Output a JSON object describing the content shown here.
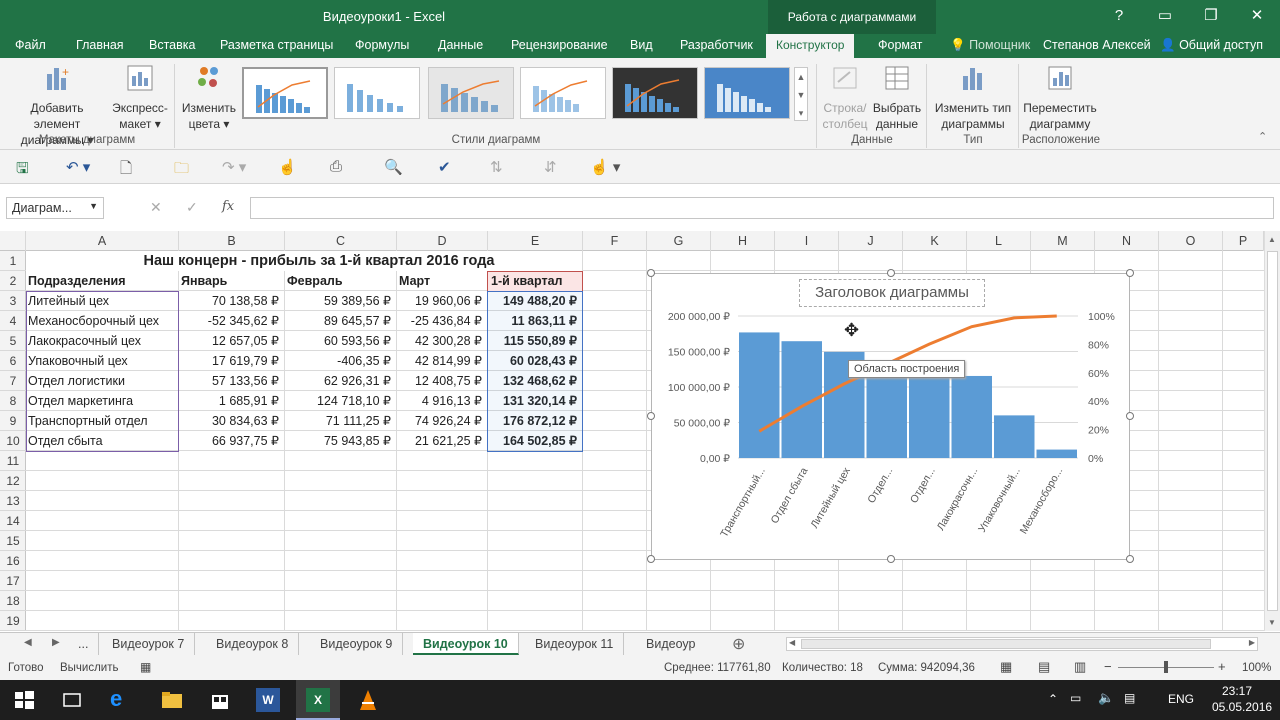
{
  "window": {
    "title": "Видеоуроки1 - Excel",
    "context_group": "Работа с диаграммами",
    "controls": [
      "?",
      "▭",
      "❐",
      "✕"
    ]
  },
  "ribbon_tabs": [
    "Файл",
    "Главная",
    "Вставка",
    "Разметка страницы",
    "Формулы",
    "Данные",
    "Рецензирование",
    "Вид",
    "Разработчик",
    "Конструктор",
    "Формат"
  ],
  "tell_me": "Помощник",
  "user_name": "Степанов Алексей",
  "share_label": "Общий доступ",
  "ribbon": {
    "add_element": [
      "Добавить элемент",
      "диаграммы ▾"
    ],
    "express_layout": [
      "Экспресс-",
      "макет ▾"
    ],
    "change_colors": [
      "Изменить",
      "цвета ▾"
    ],
    "group_layouts": "Макеты диаграмм",
    "group_styles": "Стили диаграмм",
    "row_col": [
      "Строка/",
      "столбец"
    ],
    "select_data": [
      "Выбрать",
      "данные"
    ],
    "group_data": "Данные",
    "change_type": [
      "Изменить тип",
      "диаграммы"
    ],
    "group_type": "Тип",
    "move_chart": [
      "Переместить",
      "диаграмму"
    ],
    "group_location": "Расположение"
  },
  "namebox": "Диаграм...",
  "fx": "fx",
  "columns": [
    "A",
    "B",
    "C",
    "D",
    "E",
    "F",
    "G",
    "H",
    "I",
    "J",
    "K",
    "L",
    "M",
    "N",
    "O",
    "P"
  ],
  "rows": [
    "1",
    "2",
    "3",
    "4",
    "5",
    "6",
    "7",
    "8",
    "9",
    "10",
    "11",
    "12",
    "13",
    "14",
    "15",
    "16",
    "17",
    "18",
    "19"
  ],
  "sheet_title": "Наш концерн - прибыль за 1-й квартал 2016 года",
  "table_headers": [
    "Подразделения",
    "Январь",
    "Февраль",
    "Март",
    "1-й квартал"
  ],
  "table_rows": [
    [
      "Литейный цех",
      "70 138,58 ₽",
      "59 389,56 ₽",
      "19 960,06 ₽",
      "149 488,20 ₽"
    ],
    [
      "Механосборочный цех",
      "-52 345,62 ₽",
      "89 645,57 ₽",
      "-25 436,84 ₽",
      "11 863,11 ₽"
    ],
    [
      "Лакокрасочный цех",
      "12 657,05 ₽",
      "60 593,56 ₽",
      "42 300,28 ₽",
      "115 550,89 ₽"
    ],
    [
      "Упаковочный цех",
      "17 619,79 ₽",
      "-406,35 ₽",
      "42 814,99 ₽",
      "60 028,43 ₽"
    ],
    [
      "Отдел логистики",
      "57 133,56 ₽",
      "62 926,31 ₽",
      "12 408,75 ₽",
      "132 468,62 ₽"
    ],
    [
      "Отдел маркетинга",
      "1 685,91 ₽",
      "124 718,10 ₽",
      "4 916,13 ₽",
      "131 320,14 ₽"
    ],
    [
      "Транспортный отдел",
      "30 834,63 ₽",
      "71 111,25 ₽",
      "74 926,24 ₽",
      "176 872,12 ₽"
    ],
    [
      "Отдел сбыта",
      "66 937,75 ₽",
      "75 943,85 ₽",
      "21 621,25 ₽",
      "164 502,85 ₽"
    ]
  ],
  "chart_data": {
    "type": "bar",
    "title": "Заголовок диаграммы",
    "categories": [
      "Транспортный...",
      "Отдел сбыта",
      "Литейный цех",
      "Отдел...",
      "Отдел...",
      "Лакокрасочн...",
      "Упаковочный...",
      "Механосборо..."
    ],
    "values": [
      176872.12,
      164502.85,
      149488.2,
      132468.62,
      131320.14,
      115550.89,
      60028.43,
      11863.11
    ],
    "line_values": [
      18.8,
      36.3,
      52.2,
      66.2,
      80.2,
      92.5,
      98.7,
      100
    ],
    "y_ticks": [
      "200 000,00 ₽",
      "150 000,00 ₽",
      "100 000,00 ₽",
      "50 000,00 ₽",
      "0,00 ₽"
    ],
    "y2_ticks": [
      "100%",
      "80%",
      "60%",
      "40%",
      "20%",
      "0%"
    ],
    "ylim": [
      0,
      200000
    ],
    "y2lim": [
      0,
      100
    ],
    "bar_color": "#5b9bd5",
    "line_color": "#ed7d31",
    "tooltip": "Область построения"
  },
  "sheet_tabs": [
    "...",
    "Видеоурок 7",
    "Видеоурок 8",
    "Видеоурок 9",
    "Видеоурок 10",
    "Видеоурок 11",
    "Видеоур"
  ],
  "status": {
    "ready": "Готово",
    "calc": "Вычислить",
    "average": "Среднее: 117761,80",
    "count": "Количество: 18",
    "sum": "Сумма: 942094,36",
    "zoom": "100%"
  },
  "taskbar": {
    "lang": "ENG",
    "time": "23:17",
    "date": "05.05.2016"
  }
}
